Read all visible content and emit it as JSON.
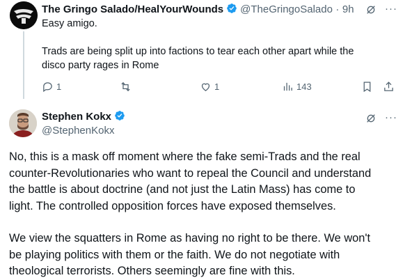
{
  "reply_tweet": {
    "author_name": "The Gringo Salado/HealYourWounds",
    "handle": "@TheGringoSalado",
    "separator": "·",
    "time": "9h",
    "text_line1": "Easy amigo.",
    "text_line2": "Trads are being split up into factions to tear each other apart while the",
    "text_line3": "disco party rages in Rome",
    "reply_count": "1",
    "retweet_count": "",
    "like_count": "1",
    "view_count": "143"
  },
  "main_tweet": {
    "author_name": "Stephen Kokx",
    "handle": "@StephenKokx",
    "paragraph1_lines": [
      "No, this is a mask off moment where the fake semi-Trads and the real",
      "counter-Revolutionaries who want to repeal the Council and understand",
      "the battle is about doctrine (and not just the Latin Mass) has come to",
      "light. The controlled opposition forces have exposed themselves."
    ],
    "paragraph2_lines": [
      "We view the squatters in Rome as having no right to be there. We won't",
      "be playing politics with them or the faith. We do not negotiate with",
      "theological terrorists. Others seemingly are fine with this."
    ]
  },
  "colors": {
    "verified_blue": "#1d9bf0",
    "muted_gray": "#536471"
  }
}
